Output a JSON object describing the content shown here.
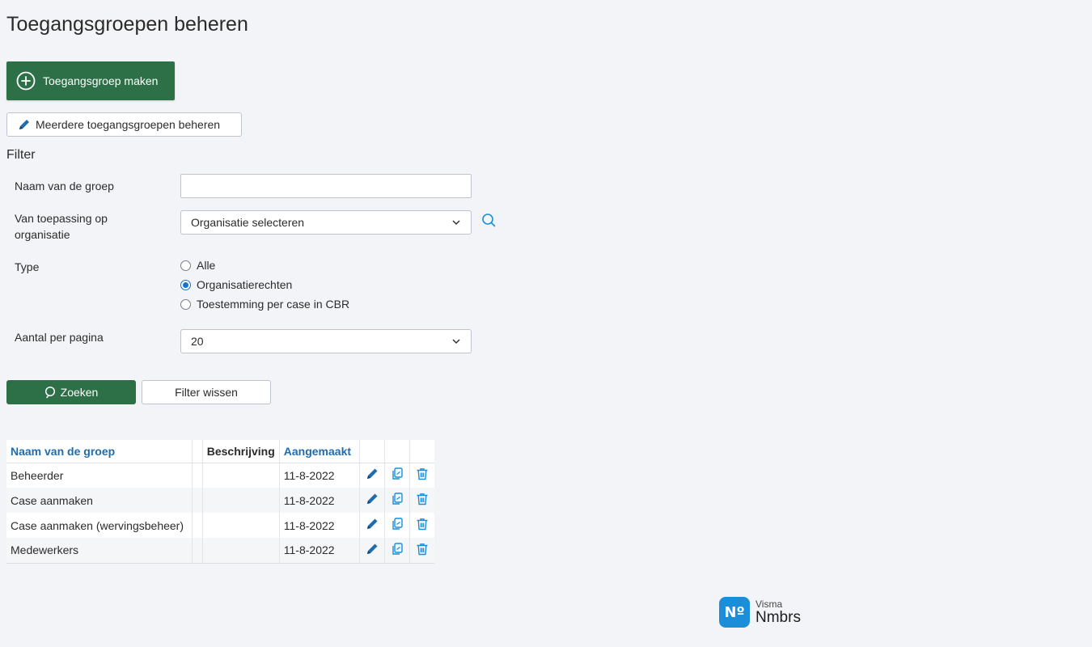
{
  "page": {
    "title": "Toegangsgroepen beheren"
  },
  "actions": {
    "create_label": "Toegangsgroep maken",
    "manage_multiple_label": "Meerdere toegangsgroepen beheren"
  },
  "filter": {
    "heading": "Filter",
    "name_label": "Naam van de groep",
    "name_value": "",
    "org_label_line1": "Van toepassing op",
    "org_label_line2": "organisatie",
    "org_selected": "Organisatie selecteren",
    "type_label": "Type",
    "type_options": [
      "Alle",
      "Organisatierechten",
      "Toestemming per case in CBR"
    ],
    "type_selected_index": 1,
    "per_page_label": "Aantal per pagina",
    "per_page_value": "20",
    "search_label": "Zoeken",
    "clear_label": "Filter wissen"
  },
  "table": {
    "headers": {
      "name": "Naam van de groep",
      "description": "Beschrijving",
      "created": "Aangemaakt"
    },
    "rows": [
      {
        "name": "Beheerder",
        "description": "",
        "created": "11-8-2022"
      },
      {
        "name": "Case aanmaken",
        "description": "",
        "created": "11-8-2022"
      },
      {
        "name": "Case aanmaken (wervingsbeheer)",
        "description": "",
        "created": "11-8-2022"
      },
      {
        "name": "Medewerkers",
        "description": "",
        "created": "11-8-2022"
      }
    ]
  },
  "branding": {
    "company": "Visma",
    "product": "Nmbrs",
    "badge_glyph": "Nº"
  },
  "colors": {
    "primary_green": "#2d7047",
    "link_blue": "#1f6cb0",
    "icon_blue": "#1a8ed8",
    "background": "#f3f4f7"
  },
  "icons": {
    "create": "plus-circle-icon",
    "manage_multiple": "pencil-icon",
    "org_search": "search-icon",
    "edit": "pencil-icon",
    "copy": "copy-icon",
    "delete": "trash-icon"
  }
}
